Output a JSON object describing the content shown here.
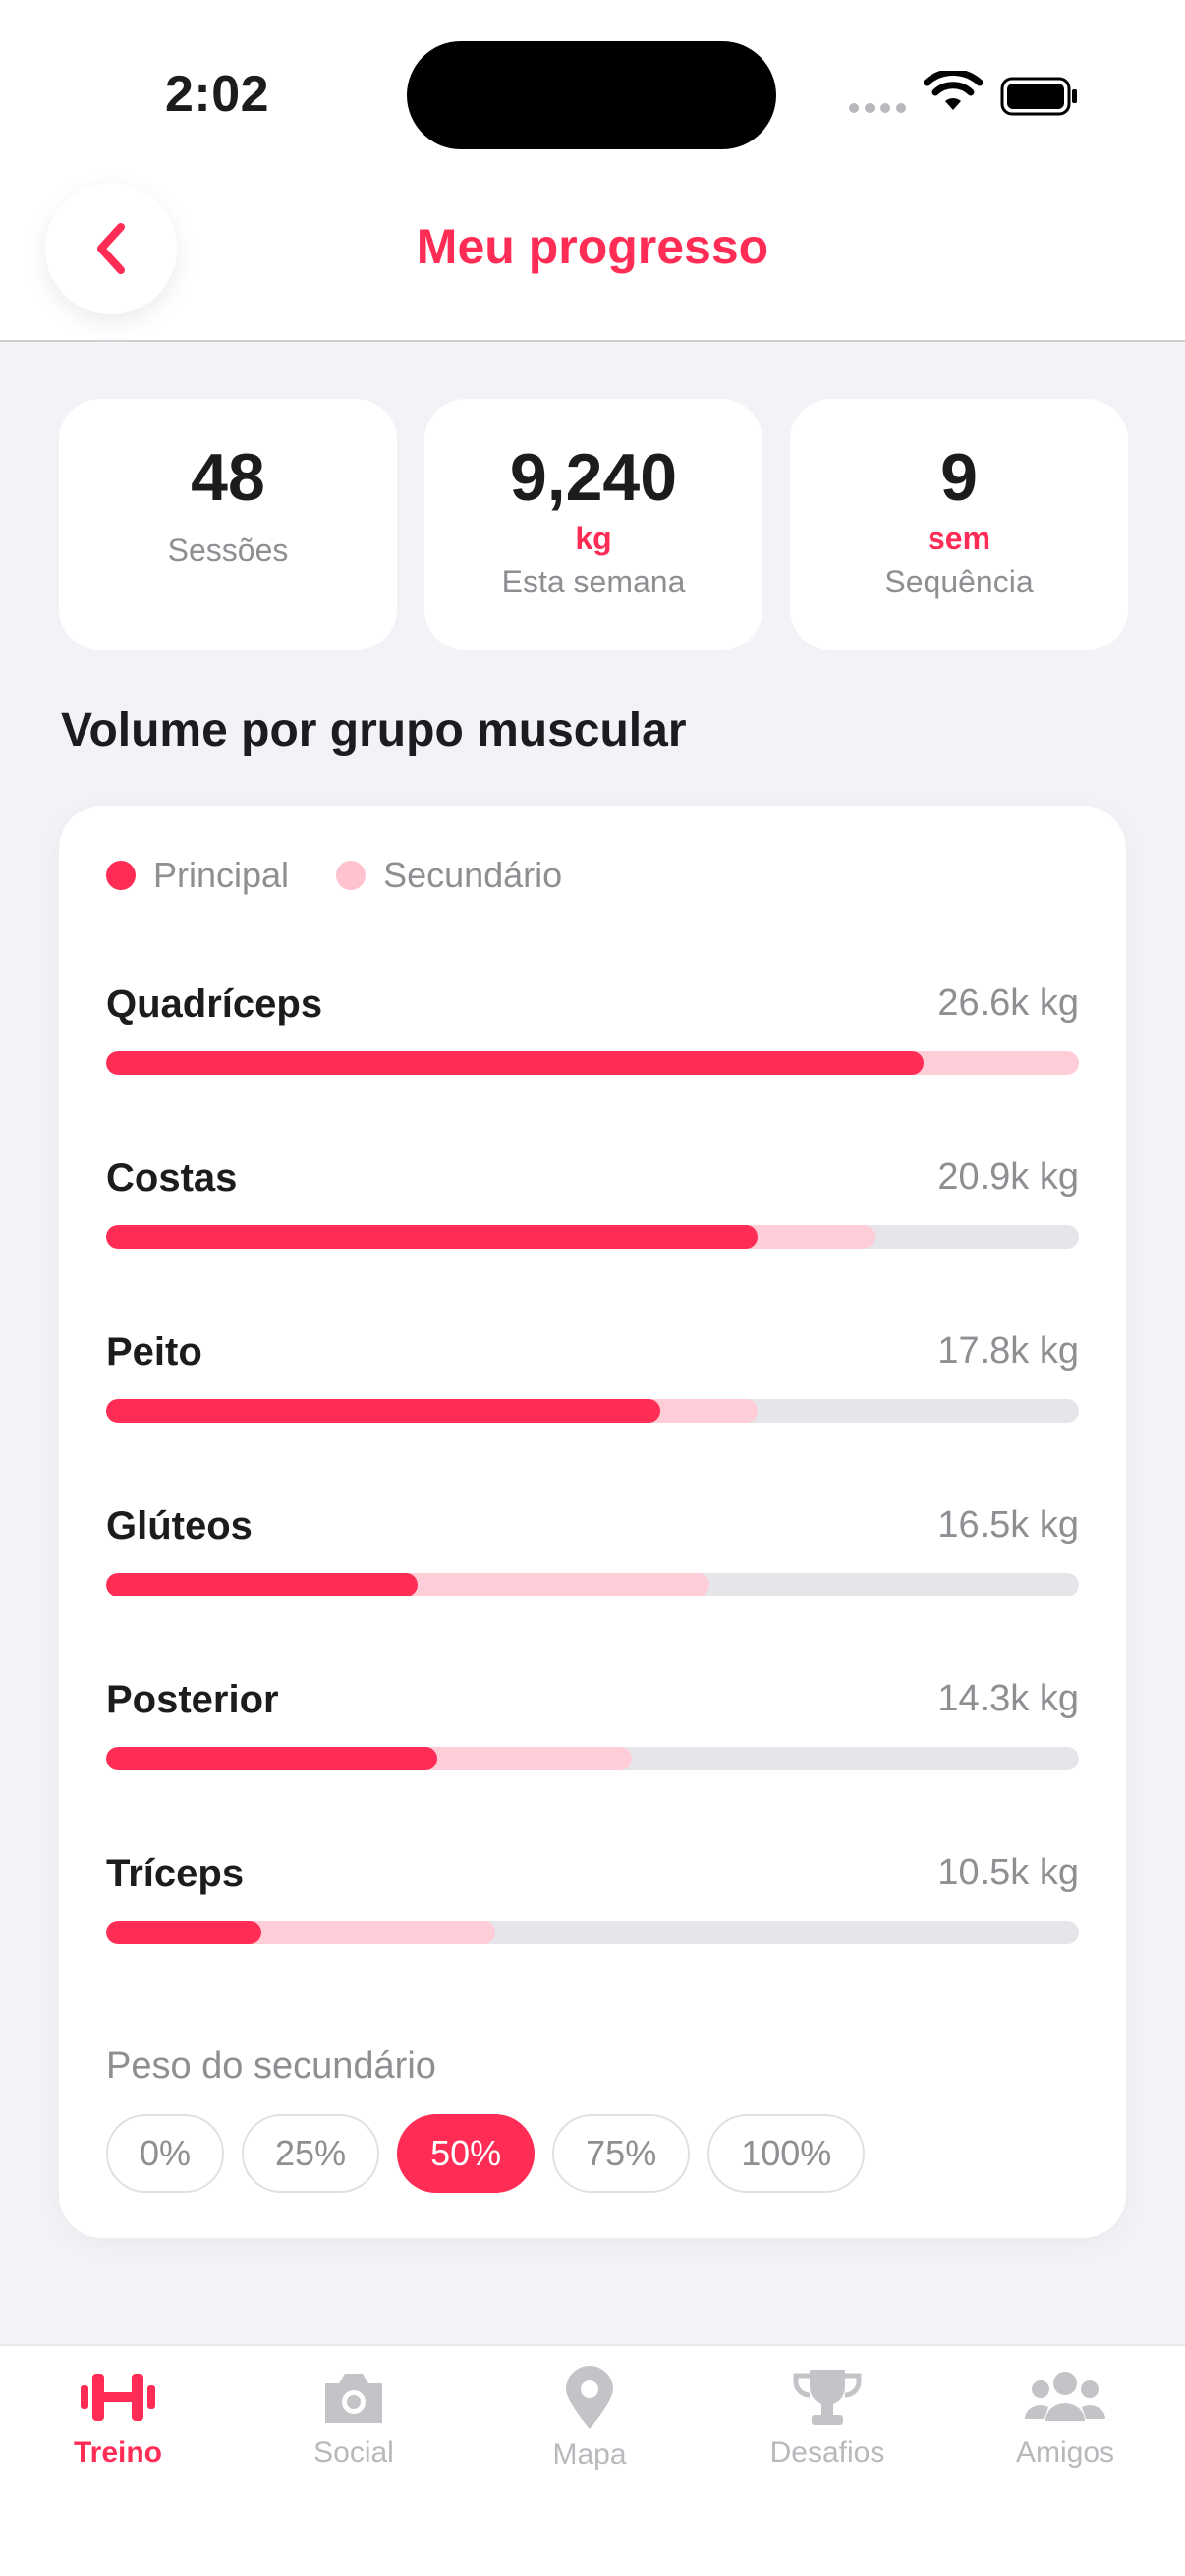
{
  "status_bar": {
    "time": "2:02"
  },
  "header": {
    "title": "Meu progresso",
    "back_icon": "chevron-left-icon"
  },
  "stats": [
    {
      "value": "48",
      "unit": "",
      "label": "Sessões"
    },
    {
      "value": "9,240",
      "unit": "kg",
      "label": "Esta semana"
    },
    {
      "value": "9",
      "unit": "sem",
      "label": "Sequência"
    }
  ],
  "section": {
    "title": "Volume por grupo muscular"
  },
  "legend": {
    "primary": "Principal",
    "secondary": "Secundário"
  },
  "colors": {
    "accent": "#ff2d55",
    "secondary": "#ffcdd8",
    "track": "#e5e5ea"
  },
  "muscles": [
    {
      "name": "Quadríceps",
      "value": "26.6k kg",
      "primary_pct": 84,
      "total_pct": 100
    },
    {
      "name": "Costas",
      "value": "20.9k kg",
      "primary_pct": 67,
      "total_pct": 79
    },
    {
      "name": "Peito",
      "value": "17.8k kg",
      "primary_pct": 57,
      "total_pct": 67
    },
    {
      "name": "Glúteos",
      "value": "16.5k kg",
      "primary_pct": 32,
      "total_pct": 62
    },
    {
      "name": "Posterior",
      "value": "14.3k kg",
      "primary_pct": 34,
      "total_pct": 54
    },
    {
      "name": "Tríceps",
      "value": "10.5k kg",
      "primary_pct": 16,
      "total_pct": 40
    }
  ],
  "secondary_weight": {
    "label": "Peso do secundário",
    "options": [
      "0%",
      "25%",
      "50%",
      "75%",
      "100%"
    ],
    "selected": "50%"
  },
  "tabs": [
    {
      "label": "Treino",
      "icon": "dumbbell-icon",
      "active": true
    },
    {
      "label": "Social",
      "icon": "camera-icon",
      "active": false
    },
    {
      "label": "Mapa",
      "icon": "map-pin-icon",
      "active": false
    },
    {
      "label": "Desafios",
      "icon": "trophy-icon",
      "active": false
    },
    {
      "label": "Amigos",
      "icon": "people-icon",
      "active": false
    }
  ]
}
